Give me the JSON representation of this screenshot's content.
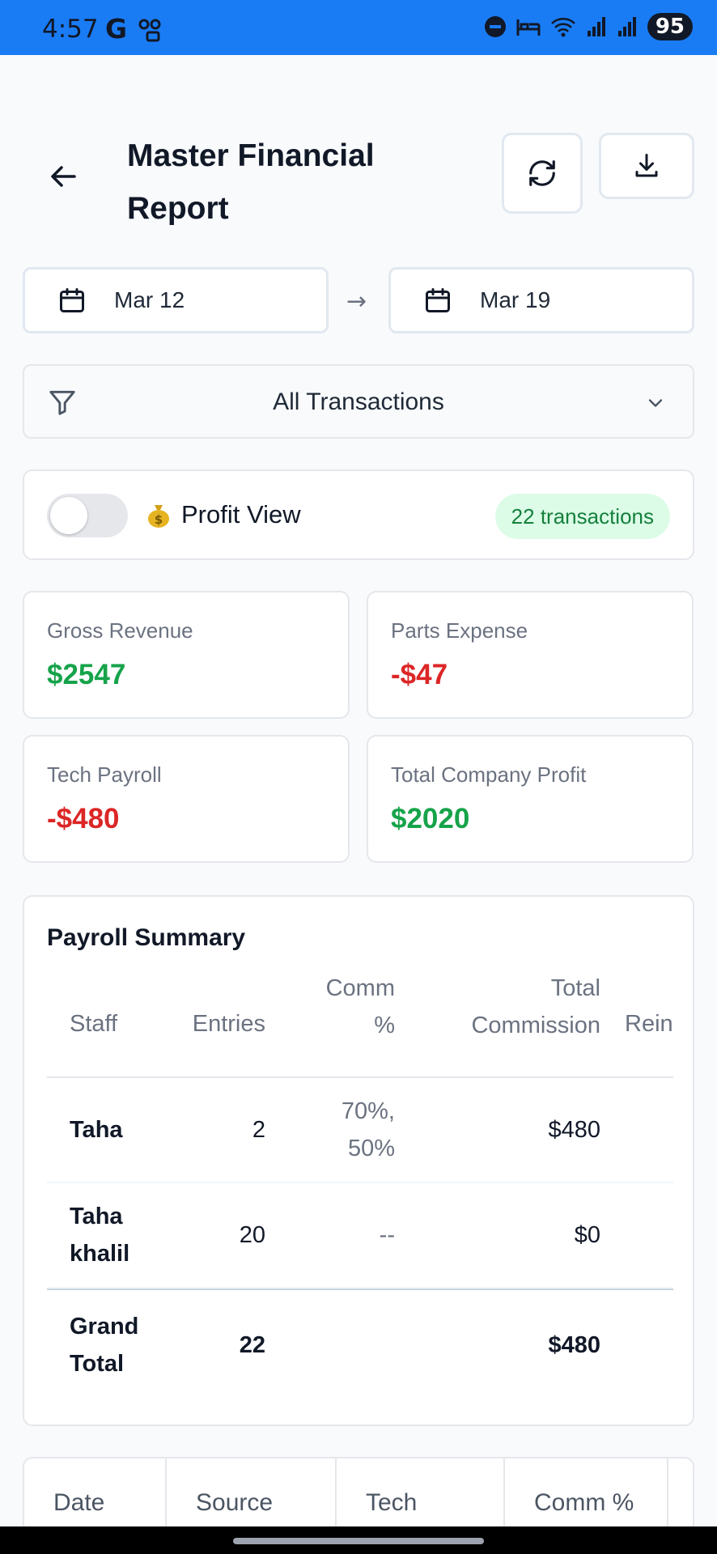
{
  "status_bar": {
    "time": "4:57",
    "carrier_icon": "G",
    "battery": "95"
  },
  "header": {
    "title": "Master Financial Report",
    "back_icon": "back-arrow-icon",
    "refresh_icon": "refresh-icon",
    "download_icon": "download-icon"
  },
  "date_range": {
    "start": "Mar 12",
    "end": "Mar 19",
    "separator": "→"
  },
  "filter": {
    "selected": "All Transactions"
  },
  "profit_view": {
    "label": "Profit View",
    "toggle_on": false,
    "transaction_count": "22 transactions"
  },
  "stats": {
    "gross_revenue": {
      "label": "Gross Revenue",
      "value": "$2547"
    },
    "parts_expense": {
      "label": "Parts Expense",
      "value": "-$47"
    },
    "tech_payroll": {
      "label": "Tech Payroll",
      "value": "-$480"
    },
    "total_profit": {
      "label": "Total Company Profit",
      "value": "$2020"
    }
  },
  "payroll": {
    "title": "Payroll Summary",
    "columns": {
      "staff": "Staff",
      "entries": "Entries",
      "comm_line1": "Comm",
      "comm_line2": "%",
      "total_line1": "Total",
      "total_line2": "Commission",
      "reim": "Rein"
    },
    "rows": [
      {
        "staff_line1": "Taha",
        "staff_line2": "",
        "entries": "2",
        "comm_line1": "70%,",
        "comm_line2": "50%",
        "total": "$480"
      },
      {
        "staff_line1": "Taha",
        "staff_line2": "khalil",
        "entries": "20",
        "comm_line1": "--",
        "comm_line2": "",
        "total": "$0"
      }
    ],
    "grand_total": {
      "label_line1": "Grand",
      "label_line2": "Total",
      "entries": "22",
      "total": "$480"
    }
  },
  "transactions_table": {
    "columns": [
      "Date",
      "Source",
      "Tech",
      "Comm %"
    ]
  },
  "colors": {
    "status_bar": "#1a7cf5",
    "positive": "#16a34a",
    "negative": "#dc2626",
    "badge_bg": "#dcfce7",
    "badge_text": "#15803d"
  }
}
